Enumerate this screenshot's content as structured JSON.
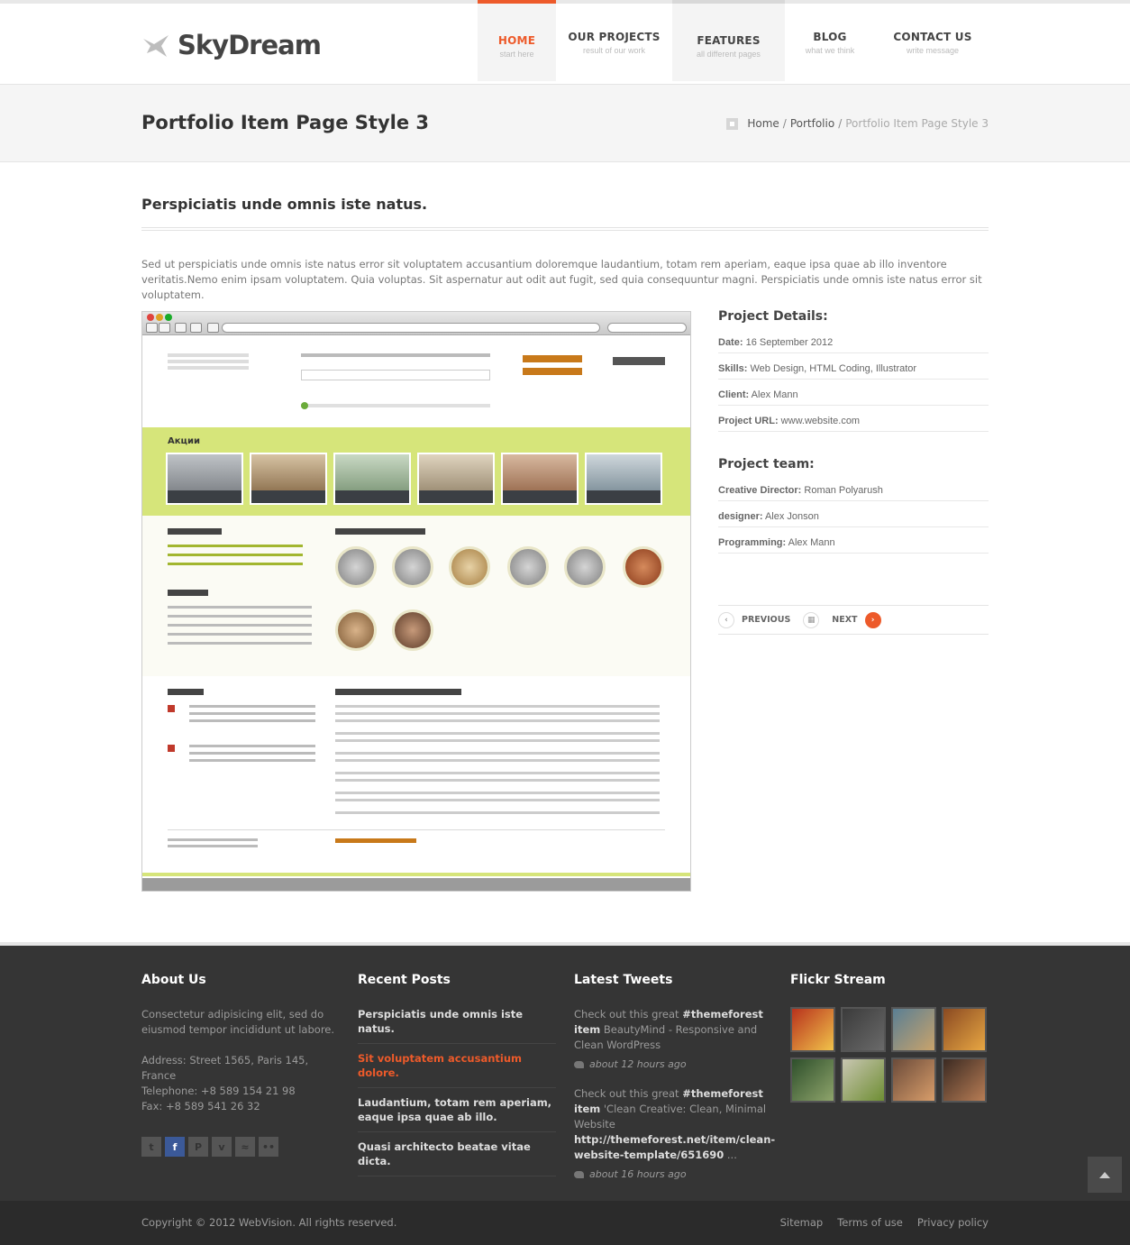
{
  "header": {
    "logo": "SkyDream",
    "nav": [
      {
        "label": "HOME",
        "sub": "start here"
      },
      {
        "label": "OUR PROJECTS",
        "sub": "result of our work"
      },
      {
        "label": "FEATURES",
        "sub": "all different pages"
      },
      {
        "label": "BLOG",
        "sub": "what we think"
      },
      {
        "label": "CONTACT US",
        "sub": "write message"
      }
    ]
  },
  "titlebar": {
    "title": "Portfolio Item Page Style 3",
    "breadcrumb": [
      "Home",
      "Portfolio",
      "Portfolio Item Page Style 3"
    ]
  },
  "content": {
    "heading": "Perspiciatis unde omnis iste natus.",
    "intro": "Sed ut perspiciatis unde omnis iste natus error sit voluptatem accusantium doloremque laudantium, totam rem aperiam, eaque ipsa quae ab illo inventore veritatis.Nemo enim ipsam voluptatem. Quia voluptas. Sit aspernatur aut odit aut fugit, sed quia consequuntur magni. Perspiciatis unde omnis iste natus error sit voluptatem."
  },
  "details": {
    "title": "Project Details:",
    "rows": [
      {
        "k": "Date:",
        "v": " 16 September 2012"
      },
      {
        "k": "Skills:",
        "v": " Web Design, HTML Coding, Illustrator"
      },
      {
        "k": "Client:",
        "v": "  Alex Mann"
      },
      {
        "k": "Project URL:",
        "v": "  www.website.com"
      }
    ],
    "team_title": "Project team:",
    "team": [
      {
        "k": "Creative Director:",
        "v": " Roman Polyarush"
      },
      {
        "k": "designer:",
        "v": " Alex Jonson"
      },
      {
        "k": "Programming:",
        "v": "  Alex Mann"
      }
    ],
    "prev": "PREVIOUS",
    "next": "NEXT"
  },
  "footer": {
    "about": {
      "title": "About Us",
      "text": "Consectetur adipisicing elit, sed do eiusmod tempor incididunt ut labore.",
      "address": "Address: Street 1565, Paris 145, France",
      "telephone": "Telephone: +8 589 154 21 98",
      "fax": "Fax: +8 589 541 26 32"
    },
    "posts": {
      "title": "Recent Posts",
      "items": [
        "Perspiciatis unde omnis iste natus.",
        "Sit voluptatem accusantium dolore.",
        "Laudantium, totam rem aperiam, eaque ipsa quae ab illo.",
        "Quasi architecto beatae vitae dicta."
      ]
    },
    "tweets": {
      "title": "Latest Tweets",
      "items": [
        {
          "pre": "Check out this great ",
          "tag": "#themeforest item",
          "text": " BeautyMind - Responsive and Clean WordPress",
          "time": "about 12 hours ago"
        },
        {
          "pre": "Check out this great ",
          "tag": "#themeforest item",
          "text": " 'Clean Creative: Clean, Minimal Website ",
          "link": "http://themeforest.net/item/clean-website-template/651690",
          "suffix": " ...",
          "time": "about 16 hours ago"
        }
      ]
    },
    "flickr": {
      "title": "Flickr Stream"
    },
    "copyright": "Copyright © 2012 WebVision. All rights reserved.",
    "links": [
      "Sitemap",
      "Terms of use",
      "Privacy policy"
    ]
  },
  "colors": {
    "accent": "#ed5a2a",
    "footer": "#353535",
    "screenshot_green": "#d6e57a"
  },
  "icons": [
    "logo-bird-icon",
    "breadcrumb-home-icon",
    "twitter-icon",
    "facebook-icon",
    "pinterest-icon",
    "vimeo-icon",
    "rss-icon",
    "flickr-icon",
    "tweet-bird-icon",
    "back-to-top-icon"
  ]
}
